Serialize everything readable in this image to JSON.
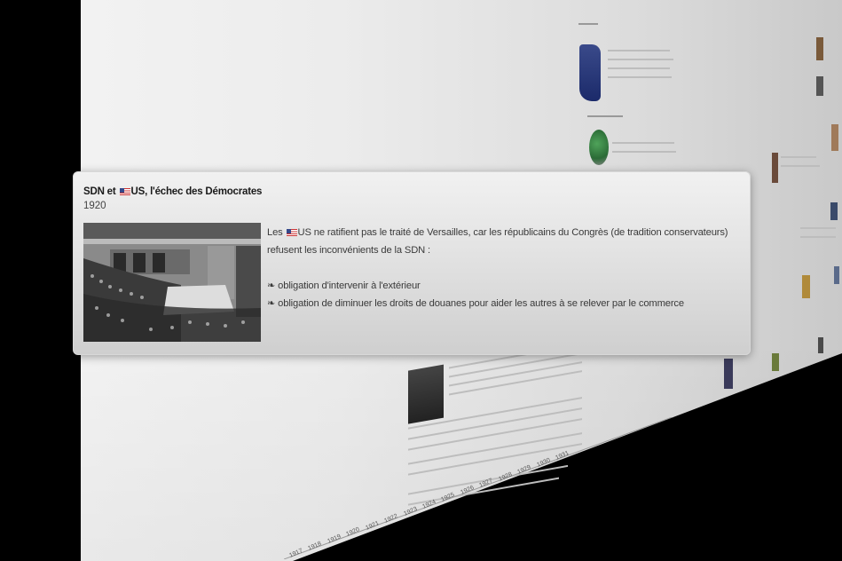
{
  "popup": {
    "title_prefix": "SDN et ",
    "title_suffix": "US, l'échec des Démocrates",
    "year": "1920",
    "body_prefix": "Les ",
    "body_line1": "US ne ratifient pas le traité de Versailles, car les républicains du Congrès (de tradition conservateurs)",
    "body_line2": "refusent les inconvénients de la SDN :",
    "bullets": [
      "❧ obligation d'intervenir à l'extérieur",
      "❧  obligation de diminuer les droits de douanes pour aider les autres à   se relever par le commerce"
    ],
    "photo_icon": "congress-photo"
  },
  "timeline": {
    "years": [
      "1917",
      "1918",
      "1919",
      "1920",
      "1921",
      "1922",
      "1923",
      "1924",
      "1925",
      "1926",
      "1927",
      "1928",
      "1929",
      "1930",
      "1931"
    ]
  },
  "colors": {
    "background": "#000000",
    "plane": "#ececec",
    "card": "#e4e4e4",
    "title": "#1a1a1a"
  }
}
